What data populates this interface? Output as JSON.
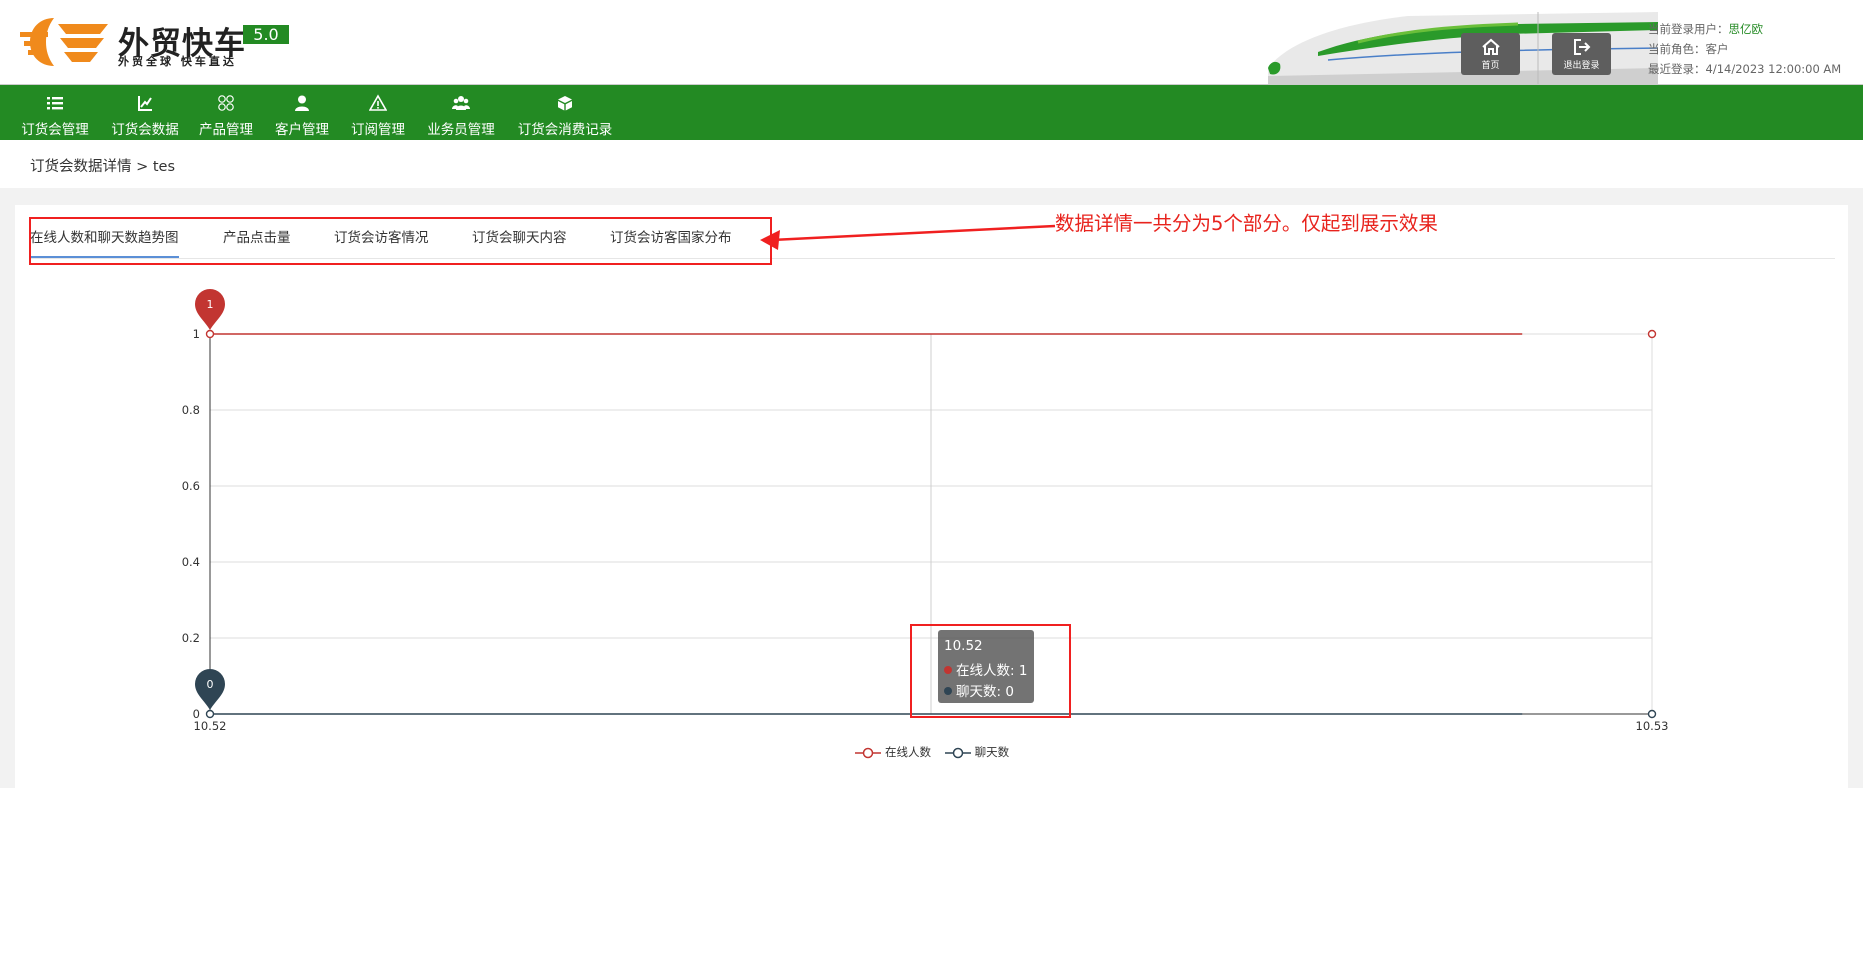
{
  "header": {
    "logo_title": "外贸快车",
    "logo_slogan": "外贸全球 快车直达",
    "version": "5.0",
    "home_label": "首页",
    "logout_label": "退出登录",
    "user_label": "当前登录用户：",
    "user_name": "思亿欧",
    "role_label": "当前角色：",
    "role_value": "客户",
    "last_login_label": "最近登录：",
    "last_login_value": "4/14/2023 12:00:00 AM"
  },
  "nav": {
    "items": [
      {
        "label": "订货会管理",
        "icon": "list-icon"
      },
      {
        "label": "订货会数据",
        "icon": "chart-icon"
      },
      {
        "label": "产品管理",
        "icon": "grid-icon"
      },
      {
        "label": "客户管理",
        "icon": "user-icon"
      },
      {
        "label": "订阅管理",
        "icon": "warning-icon"
      },
      {
        "label": "业务员管理",
        "icon": "users-icon"
      },
      {
        "label": "订货会消费记录",
        "icon": "cube-icon"
      }
    ]
  },
  "breadcrumb": "订货会数据详情 > tes",
  "tabs": [
    {
      "label": "在线人数和聊天数趋势图",
      "active": true
    },
    {
      "label": "产品点击量",
      "active": false
    },
    {
      "label": "订货会访客情况",
      "active": false
    },
    {
      "label": "订货会聊天内容",
      "active": false
    },
    {
      "label": "订货会访客国家分布",
      "active": false
    }
  ],
  "annotation": {
    "text": "数据详情一共分为5个部分。仅起到展示效果",
    "color": "#e8231d"
  },
  "tooltip": {
    "title": "10.52",
    "rows": [
      {
        "label": "在线人数: 1",
        "color": "#c23531"
      },
      {
        "label": "聊天数: 0",
        "color": "#2f4554"
      }
    ]
  },
  "chart_data": {
    "type": "line",
    "x": [
      "10.52",
      "10.53"
    ],
    "ylim": [
      0,
      1
    ],
    "yticks": [
      "0",
      "0.2",
      "0.4",
      "0.6",
      "0.8",
      "1"
    ],
    "grid": true,
    "legend_position": "bottom-center",
    "series": [
      {
        "name": "在线人数",
        "values": [
          1,
          1
        ],
        "color": "#c23531",
        "max_pin": "1"
      },
      {
        "name": "聊天数",
        "values": [
          0,
          0
        ],
        "color": "#2f4554",
        "max_pin": "0"
      }
    ]
  },
  "colors": {
    "brand_green": "#238a23",
    "logo_orange": "#f08a1c"
  }
}
